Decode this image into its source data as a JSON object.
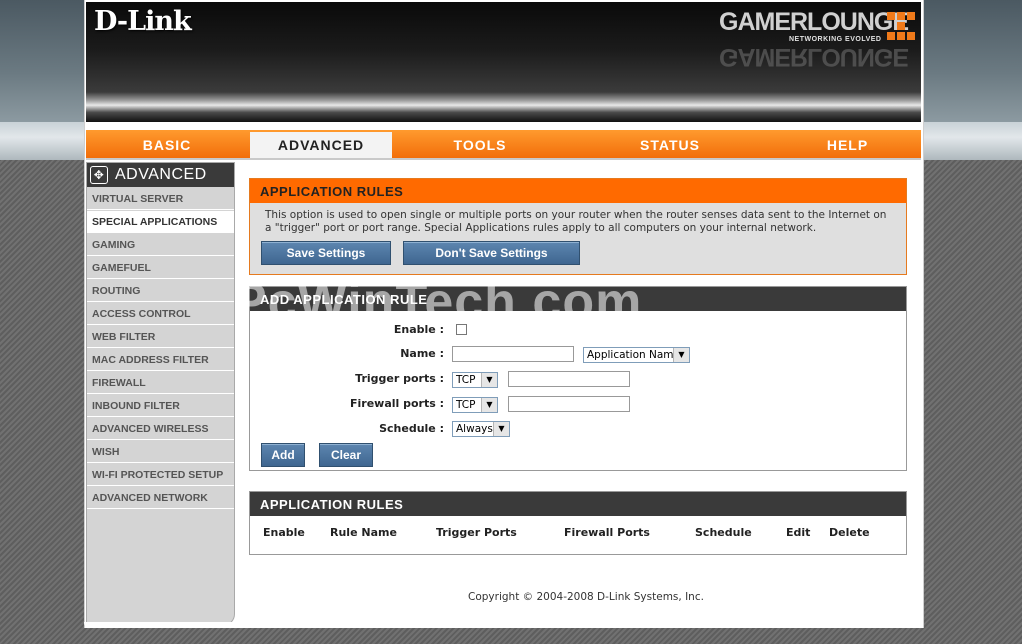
{
  "brand": {
    "logo": "D-Link",
    "product": "GAMERLOUNGE",
    "tagline": "NETWORKING EVOLVED"
  },
  "nav": {
    "tabs": [
      {
        "label": "BASIC"
      },
      {
        "label": "ADVANCED"
      },
      {
        "label": "TOOLS"
      },
      {
        "label": "STATUS"
      },
      {
        "label": "HELP"
      }
    ],
    "active": "ADVANCED"
  },
  "sidebar": {
    "title": "ADVANCED",
    "items": [
      {
        "label": "VIRTUAL SERVER"
      },
      {
        "label": "SPECIAL APPLICATIONS"
      },
      {
        "label": "GAMING"
      },
      {
        "label": "GAMEFUEL"
      },
      {
        "label": "ROUTING"
      },
      {
        "label": "ACCESS CONTROL"
      },
      {
        "label": "WEB FILTER"
      },
      {
        "label": "MAC ADDRESS FILTER"
      },
      {
        "label": "FIREWALL"
      },
      {
        "label": "INBOUND FILTER"
      },
      {
        "label": "ADVANCED WIRELESS"
      },
      {
        "label": "WISH"
      },
      {
        "label": "WI-FI PROTECTED SETUP"
      },
      {
        "label": "ADVANCED NETWORK"
      }
    ],
    "active": "SPECIAL APPLICATIONS"
  },
  "intro": {
    "title": "APPLICATION RULES",
    "description": "This option is used to open single or multiple ports on your router when the router senses data sent to the Internet on a \"trigger\" port or port range. Special Applications rules apply to all computers on your internal network.",
    "save_label": "Save Settings",
    "dont_save_label": "Don't Save Settings"
  },
  "add_rule": {
    "title": "ADD APPLICATION RULE",
    "enable_label": "Enable :",
    "name_label": "Name :",
    "name_value": "",
    "app_name_select": "Application Name",
    "trigger_label": "Trigger ports :",
    "trigger_protocol": "TCP",
    "trigger_value": "",
    "firewall_label": "Firewall ports :",
    "firewall_protocol": "TCP",
    "firewall_value": "",
    "schedule_label": "Schedule :",
    "schedule_value": "Always",
    "add_label": "Add",
    "clear_label": "Clear"
  },
  "rules_table": {
    "title": "APPLICATION RULES",
    "columns": [
      "Enable",
      "Rule Name",
      "Trigger Ports",
      "Firewall Ports",
      "Schedule",
      "Edit",
      "Delete"
    ],
    "rows": []
  },
  "footer": {
    "copyright": "Copyright © 2004-2008 D-Link Systems, Inc."
  },
  "watermark": "PcWinTech.com",
  "colors": {
    "accent": "#ff6a00",
    "button": "#4a729c",
    "dark_header": "#3a3a3a"
  }
}
